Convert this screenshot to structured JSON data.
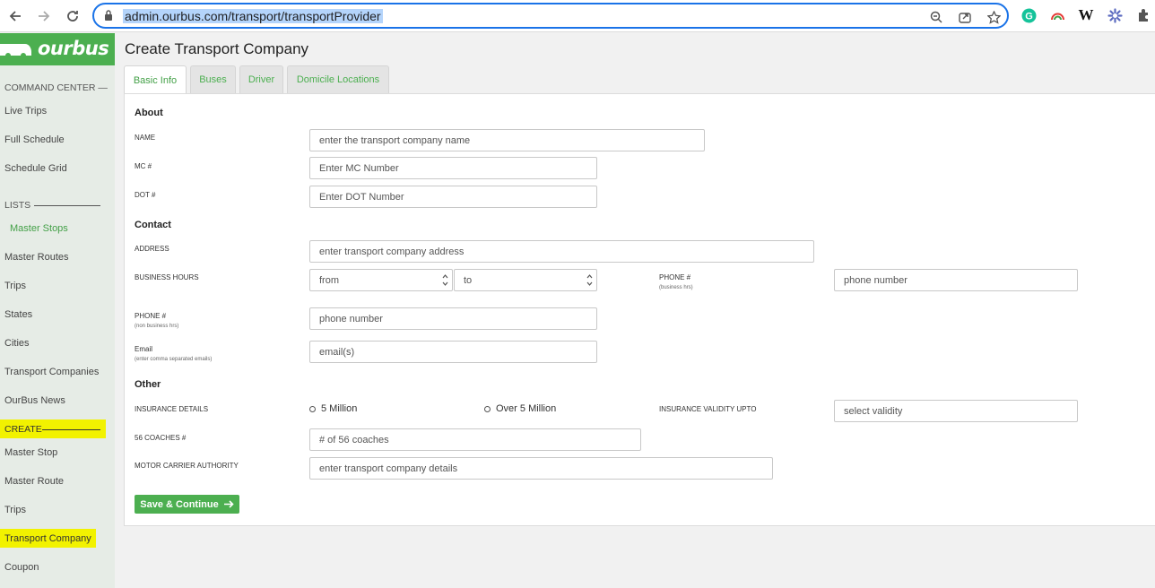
{
  "browser": {
    "url": "admin.ourbus.com/transport/transportProvider",
    "extensions": [
      "grammarly-icon",
      "rainbow-icon",
      "wikipedia-icon",
      "puzzle-flower-icon"
    ],
    "wiki_letter": "W",
    "grammarly_letter": "G"
  },
  "sidebar": {
    "logo": "ourbus",
    "command_center": "COMMAND CENTER —",
    "command_items": [
      "Live Trips",
      "Full Schedule",
      "Schedule Grid"
    ],
    "lists_label": "LISTS",
    "lists_items": [
      "Master Stops",
      "Master Routes",
      "Trips",
      "States",
      "Cities",
      "Transport Companies",
      "OurBus News"
    ],
    "create_label": "CREATE",
    "create_items": [
      "Master Stop",
      "Master Route",
      "Trips",
      "Transport Company",
      "Coupon"
    ]
  },
  "main": {
    "title": "Create Transport Company",
    "tabs": [
      "Basic Info",
      "Buses",
      "Driver",
      "Domicile Locations"
    ],
    "about": {
      "title": "About",
      "name_label": "NAME",
      "name_placeholder": "enter the transport company name",
      "mc_label": "MC #",
      "mc_placeholder": "Enter MC Number",
      "dot_label": "DOT #",
      "dot_placeholder": "Enter DOT Number"
    },
    "contact": {
      "title": "Contact",
      "address_label": "ADDRESS",
      "address_placeholder": "enter transport company address",
      "hours_label": "BUSINESS HOURS",
      "from": "from",
      "to": "to",
      "phone_label": "PHONE #",
      "phone_sub": "(business hrs)",
      "phone_placeholder": "phone number",
      "phone2_label": "PHONE #",
      "phone2_sub": "(non business hrs)",
      "phone2_placeholder": "phone number",
      "email_label": "Email",
      "email_sub": "(enter comma separated emails)",
      "email_placeholder": "email(s)"
    },
    "other": {
      "title": "Other",
      "insurance_label": "INSURANCE DETAILS",
      "option1": "5 Million",
      "option2": "Over 5 Million",
      "validity_label": "INSURANCE VALIDITY UPTO",
      "validity_placeholder": "select validity",
      "coaches_label": "56 COACHES #",
      "coaches_placeholder": "# of 56 coaches",
      "authority_label": "MOTOR CARRIER AUTHORITY",
      "authority_placeholder": "enter transport company details"
    },
    "save_label": "Save & Continue"
  },
  "colors": {
    "brand": "#4caf50",
    "highlight": "#f2f200",
    "focus": "#1a73e8"
  }
}
